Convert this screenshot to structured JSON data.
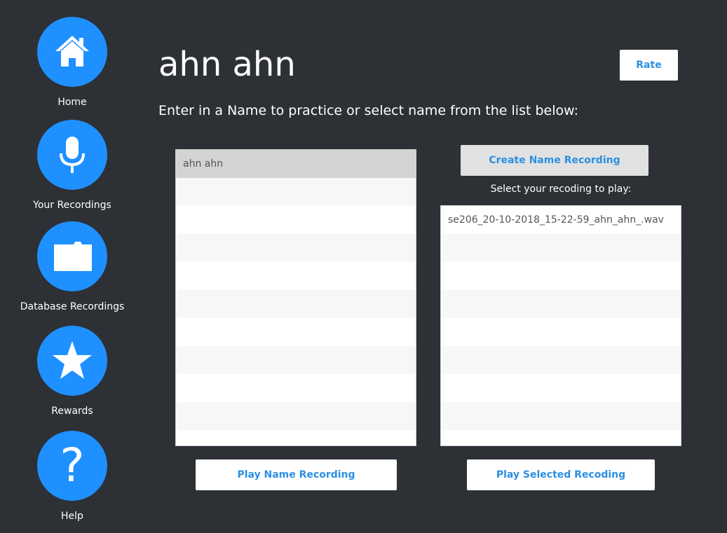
{
  "nav": {
    "home": "Home",
    "your_recordings": "Your Recordings",
    "database_recordings": "Database Recordings",
    "rewards": "Rewards",
    "help": "Help",
    "help_glyph": "?"
  },
  "header": {
    "title": "ahn ahn",
    "rate_label": "Rate"
  },
  "instruction": "Enter in a Name to practice or select name from the list below:",
  "names_list": {
    "items": [
      "ahn ahn",
      "",
      "",
      "",
      "",
      "",
      "",
      "",
      "",
      "",
      ""
    ],
    "selected": "ahn ahn"
  },
  "recordings": {
    "create_label": "Create Name Recording",
    "caption": "Select your recoding to play:",
    "items": [
      "se206_20-10-2018_15-22-59_ahn_ahn_.wav",
      "",
      "",
      "",
      "",
      "",
      "",
      "",
      ""
    ]
  },
  "buttons": {
    "play_name": "Play Name Recording",
    "play_selected": "Play Selected Recoding"
  },
  "colors": {
    "background": "#2d3035",
    "accent": "#1e90ff",
    "button_text": "#2b8fe3"
  },
  "icons": [
    "home-icon",
    "microphone-icon",
    "folder-icon",
    "star-icon",
    "question-icon"
  ]
}
